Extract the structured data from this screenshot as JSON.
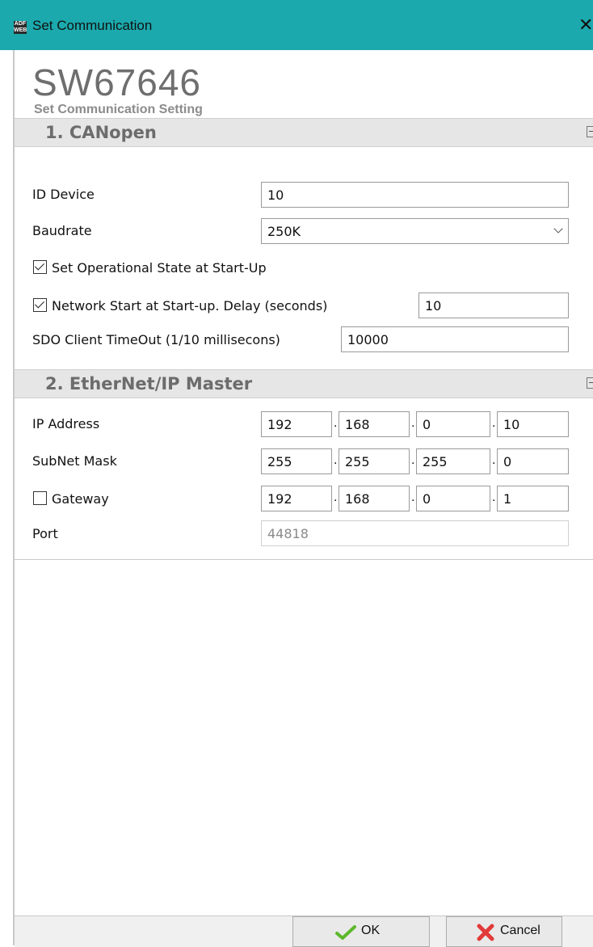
{
  "window": {
    "title": "Set Communication",
    "icon_text": "ADF WEB"
  },
  "header": {
    "product_code": "SW67646",
    "subtitle": "Set Communication Setting"
  },
  "sections": {
    "canopen": {
      "title": "1. CANopen",
      "id_device_label": "ID Device",
      "id_device_value": "10",
      "baudrate_label": "Baudrate",
      "baudrate_value": "250K",
      "operational_label": "Set Operational State at Start-Up",
      "operational_checked": true,
      "network_start_label": "Network Start at Start-up. Delay (seconds)",
      "network_start_checked": true,
      "network_start_delay": "10",
      "sdo_timeout_label": "SDO Client TimeOut (1/10 millisecons)",
      "sdo_timeout_value": "10000"
    },
    "ethernet": {
      "title": "2. EtherNet/IP Master",
      "ip_label": "IP Address",
      "ip": [
        "192",
        "168",
        "0",
        "10"
      ],
      "subnet_label": "SubNet Mask",
      "subnet": [
        "255",
        "255",
        "255",
        "0"
      ],
      "gateway_label": "Gateway",
      "gateway_checked": false,
      "gateway": [
        "192",
        "168",
        "0",
        "1"
      ],
      "port_label": "Port",
      "port_value": "44818"
    }
  },
  "buttons": {
    "ok": "OK",
    "cancel": "Cancel"
  },
  "icons": {
    "ok": "check-icon",
    "cancel": "x-icon"
  },
  "colors": {
    "titlebar": "#1ba9ad",
    "section_header": "#e6e6e6",
    "ok_check": "#5cb82a",
    "cancel_x": "#e23a3a"
  }
}
